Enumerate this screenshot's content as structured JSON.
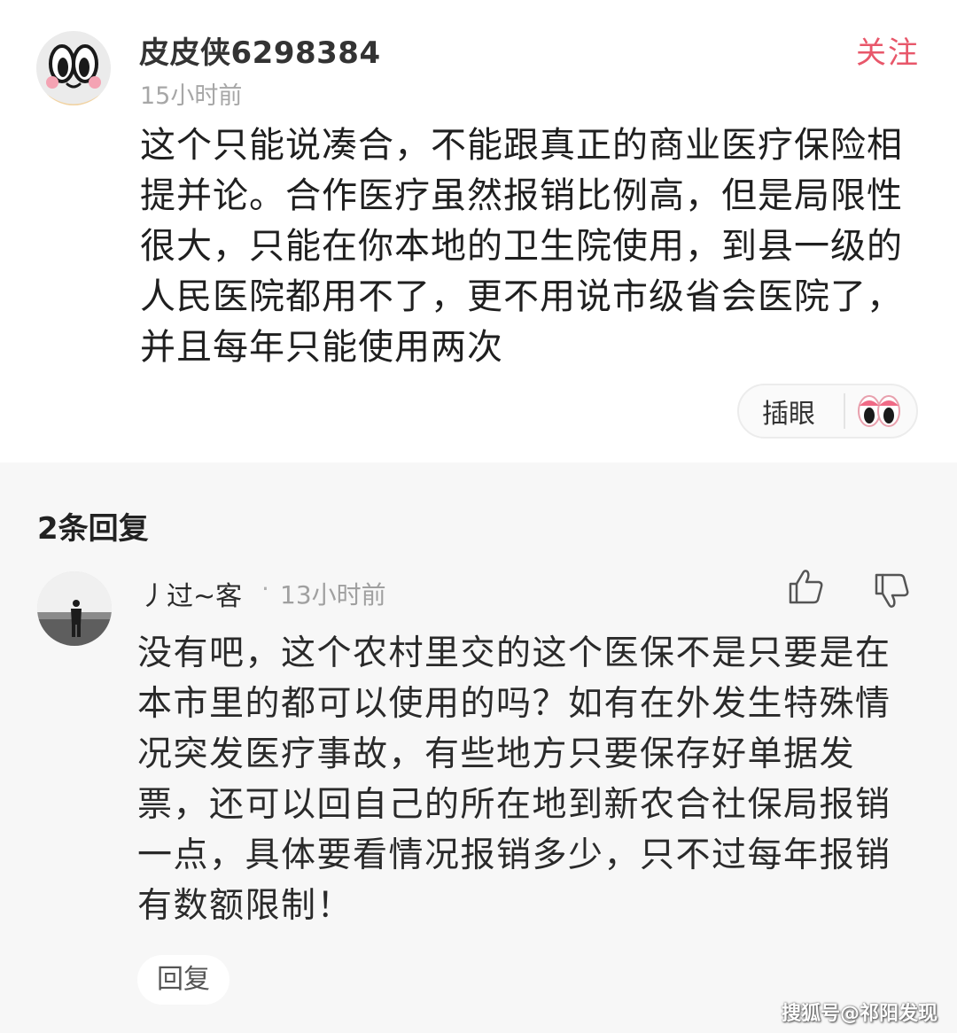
{
  "comment": {
    "username": "皮皮侠6298384",
    "time": "15小时前",
    "follow_label": "关注",
    "text": "这个只能说凑合，不能跟真正的商业医疗保险相提并论。合作医疗虽然报销比例高，但是局限性很大，只能在你本地的卫生院使用，到县一级的人民医院都用不了，更不用说市级省会医院了，并且每年只能使用两次",
    "reaction_label": "插眼",
    "avatar_icon": "cartoon-face-avatar",
    "reaction_icon": "eyes-emoji-icon"
  },
  "replies": {
    "count_label": "2条回复",
    "items": [
      {
        "username": "丿过~客",
        "separator": "·",
        "time": "13小时前",
        "text": "没有吧，这个农村里交的这个医保不是只要是在本市里的都可以使用的吗？如有在外发生特殊情况突发医疗事故，有些地方只要保存好单据发票，还可以回自己的所在地到新农合社保局报销一点，具体要看情况报销多少，只不过每年报销有数额限制！",
        "reply_label": "回复",
        "like_icon": "thumbs-up-icon",
        "dislike_icon": "thumbs-down-icon"
      }
    ]
  },
  "watermark": "搜狐号@祁阳发现",
  "colors": {
    "accent": "#e8576a",
    "muted": "#a7a7a7",
    "section_bg": "#f7f7f7"
  }
}
